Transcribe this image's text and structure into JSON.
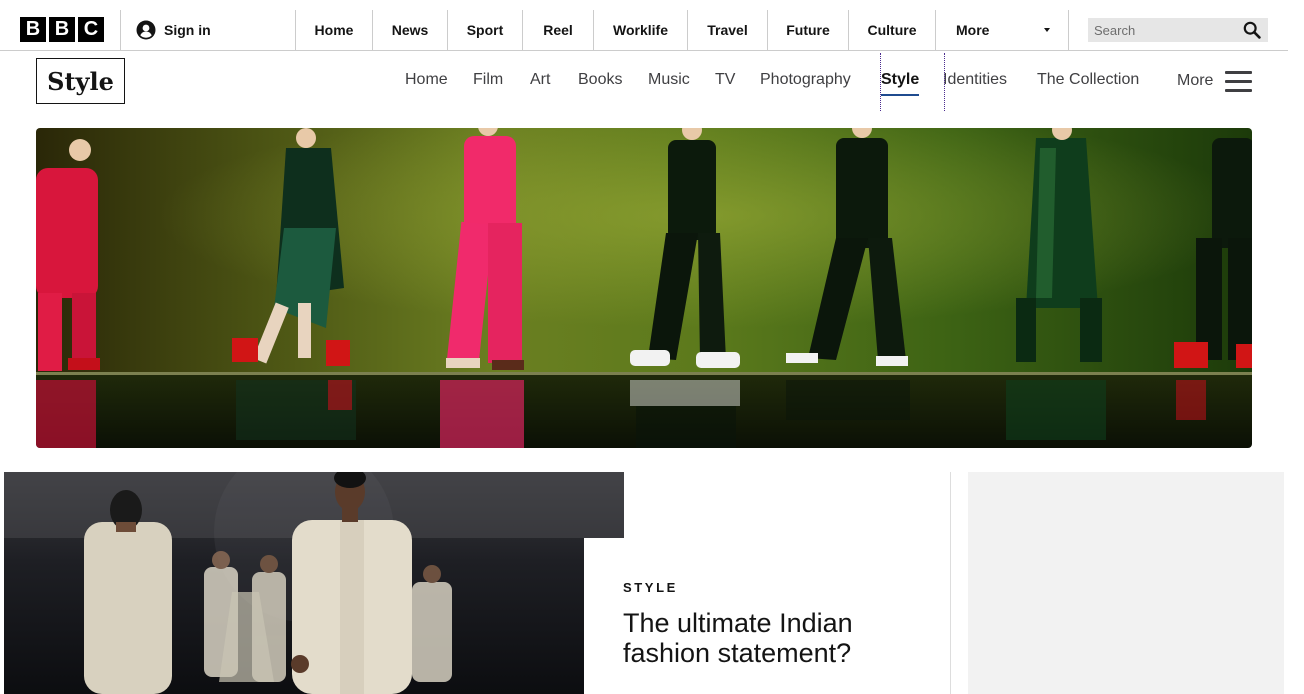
{
  "brand": {
    "letters": [
      "B",
      "B",
      "C"
    ]
  },
  "account": {
    "sign_in_label": "Sign in",
    "icon": "user-icon"
  },
  "top_nav": {
    "items": [
      "Home",
      "News",
      "Sport",
      "Reel",
      "Worklife",
      "Travel",
      "Future",
      "Culture"
    ],
    "more_label": "More"
  },
  "search": {
    "placeholder": "Search",
    "icon": "search-icon"
  },
  "section": {
    "name": "Style",
    "nav_items": [
      "Home",
      "Film",
      "Art",
      "Books",
      "Music",
      "TV",
      "Photography",
      "Style",
      "Identities",
      "The Collection"
    ],
    "active_item": "Style",
    "more_label": "More",
    "menu_icon": "hamburger-icon",
    "accent_color": "#1f4b8f"
  },
  "feature": {
    "tag": "STYLE",
    "headline": "The ultimate Indian fashion statement?"
  },
  "colors": {
    "text": "#141414",
    "border": "#cccccc",
    "search_bg": "#e6e6e6",
    "ad_bg": "#f2f2f2"
  }
}
